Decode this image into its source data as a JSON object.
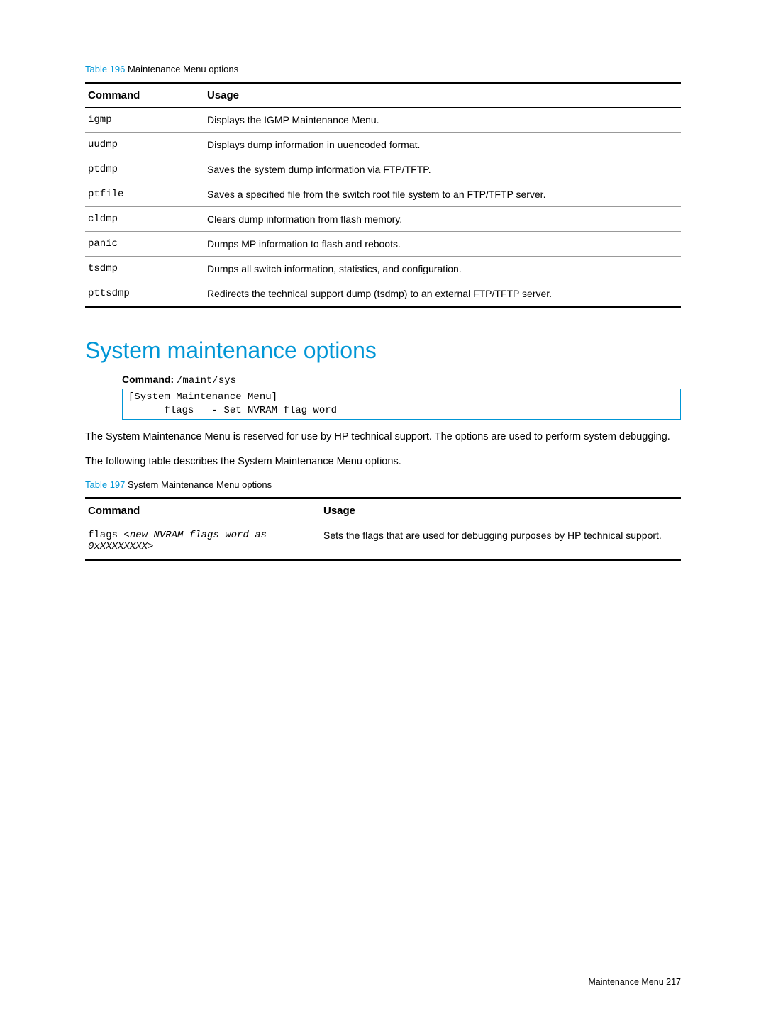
{
  "table196": {
    "caption_num": "Table 196",
    "caption_title": "  Maintenance Menu options",
    "headers": {
      "col1": "Command",
      "col2": "Usage"
    },
    "rows": [
      {
        "cmd": "igmp",
        "usage": "Displays the IGMP Maintenance Menu."
      },
      {
        "cmd": "uudmp",
        "usage": "Displays dump information in uuencoded format."
      },
      {
        "cmd": "ptdmp",
        "usage": "Saves the system dump information via FTP/TFTP."
      },
      {
        "cmd": "ptfile",
        "usage": "Saves a specified file from the switch root file system to an FTP/TFTP server."
      },
      {
        "cmd": "cldmp",
        "usage": "Clears dump information from flash memory."
      },
      {
        "cmd": "panic",
        "usage": "Dumps MP information to flash and reboots."
      },
      {
        "cmd": "tsdmp",
        "usage": "Dumps all switch information, statistics, and configuration."
      },
      {
        "cmd": "pttsdmp",
        "usage": "Redirects the technical support dump (tsdmp) to an external FTP/TFTP server."
      }
    ]
  },
  "section": {
    "heading": "System maintenance options",
    "command_label": "Command:",
    "command_path": " /maint/sys",
    "code_box": "[System Maintenance Menu]\n      flags   - Set NVRAM flag word",
    "paragraph1": "The System Maintenance Menu is reserved for use by HP technical support. The options are used to perform system debugging.",
    "paragraph2": "The following table describes the System Maintenance Menu options."
  },
  "table197": {
    "caption_num": "Table 197",
    "caption_title": "  System Maintenance Menu options",
    "headers": {
      "col1": "Command",
      "col2": "Usage"
    },
    "rows": [
      {
        "cmd_prefix": "flags ",
        "cmd_italic": "<new NVRAM flags word as 0xXXXXXXXX>",
        "usage": "Sets the flags that are used for debugging purposes by HP technical support."
      }
    ]
  },
  "footer": {
    "text": "Maintenance Menu    217"
  }
}
